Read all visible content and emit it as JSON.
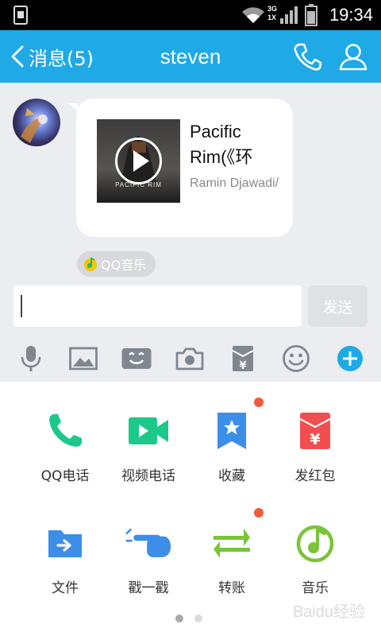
{
  "status_bar": {
    "time": "19:34",
    "network_labels": [
      "3G",
      "1X"
    ]
  },
  "header": {
    "back_label": "消息(5)",
    "title": "steven"
  },
  "message": {
    "song_title": "Pacific Rim(《环",
    "song_artist": "Ramin Djawadi/",
    "album_caption": "PACIFIC RIM",
    "source_label": "QQ音乐"
  },
  "composer": {
    "input_value": "",
    "send_label": "发送"
  },
  "toolbar": {
    "icons": [
      "microphone-icon",
      "image-icon",
      "video-message-icon",
      "camera-icon",
      "red-packet-icon",
      "emoji-icon",
      "plus-icon"
    ]
  },
  "panel": {
    "items": [
      {
        "label": "QQ电话",
        "icon": "phone-icon",
        "badge": false
      },
      {
        "label": "视频电话",
        "icon": "video-call-icon",
        "badge": false
      },
      {
        "label": "收藏",
        "icon": "favorites-icon",
        "badge": true
      },
      {
        "label": "发红包",
        "icon": "red-envelope-icon",
        "badge": false
      },
      {
        "label": "文件",
        "icon": "file-icon",
        "badge": false
      },
      {
        "label": "戳一戳",
        "icon": "poke-icon",
        "badge": false
      },
      {
        "label": "转账",
        "icon": "transfer-icon",
        "badge": true
      },
      {
        "label": "音乐",
        "icon": "music-icon",
        "badge": false
      }
    ],
    "page_count": 2,
    "current_page": 1
  },
  "watermark": "Baidu经验",
  "colors": {
    "accent": "#1fa9e6",
    "green": "#1dc98a",
    "blue": "#3d8ee8",
    "red": "#f24e50",
    "badge": "#f15a3c"
  }
}
